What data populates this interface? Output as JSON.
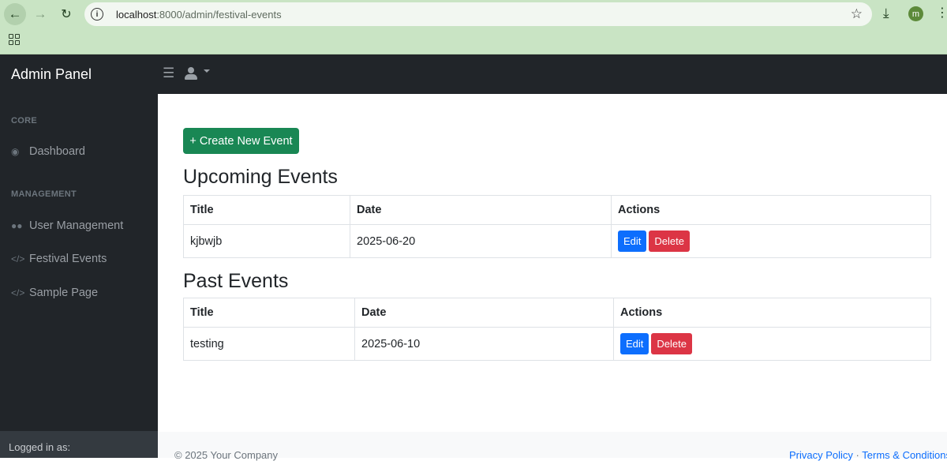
{
  "browser": {
    "url_host": "localhost",
    "url_path": ":8000/admin/festival-events",
    "profile_initial": "m"
  },
  "navbar": {
    "brand": "Admin Panel"
  },
  "sidebar": {
    "headings": [
      "CORE",
      "MANAGEMENT"
    ],
    "items": [
      {
        "label": "Dashboard",
        "icon": "dashboard-icon"
      },
      {
        "label": "User Management",
        "icon": "users-icon"
      },
      {
        "label": "Festival Events",
        "icon": "code-icon"
      },
      {
        "label": "Sample Page",
        "icon": "code-icon"
      }
    ],
    "footer": "Logged in as:"
  },
  "main": {
    "create_button": "+ Create New Event",
    "upcoming": {
      "title": "Upcoming Events",
      "columns": [
        "Title",
        "Date",
        "Actions"
      ],
      "rows": [
        {
          "title": "kjbwjb",
          "date": "2025-06-20"
        }
      ]
    },
    "past": {
      "title": "Past Events",
      "columns": [
        "Title",
        "Date",
        "Actions"
      ],
      "rows": [
        {
          "title": "testing",
          "date": "2025-06-10"
        }
      ]
    },
    "edit_label": "Edit",
    "delete_label": "Delete"
  },
  "footer": {
    "copyright": "© 2025 Your Company",
    "privacy": "Privacy Policy",
    "separator": "·",
    "terms": "Terms & Conditions"
  },
  "colors": {
    "sidebar_bg": "#212529",
    "primary": "#0d6efd",
    "success": "#198754",
    "danger": "#dc3545"
  }
}
